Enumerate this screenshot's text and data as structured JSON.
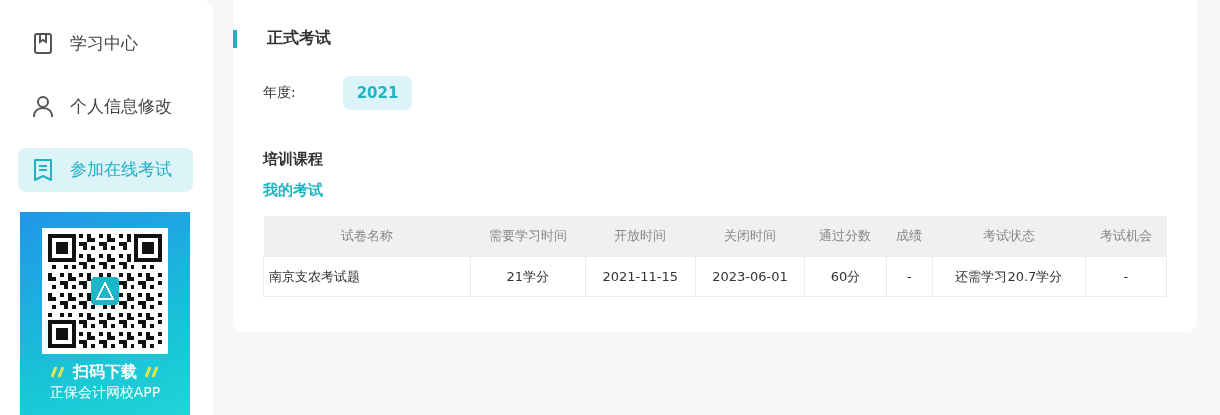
{
  "sidebar": {
    "items": [
      {
        "label": "学习中心",
        "selected": false
      },
      {
        "label": "个人信息修改",
        "selected": false
      },
      {
        "label": "参加在线考试",
        "selected": true
      }
    ],
    "banner": {
      "title": "扫码下载",
      "subtitle": "正保会计网校APP"
    }
  },
  "main": {
    "title": "正式考试",
    "year_label": "年度:",
    "years": [
      {
        "label": "2021",
        "selected": true
      }
    ],
    "section": "培训课程",
    "subsection": "我的考试",
    "table": {
      "columns": [
        "试卷名称",
        "需要学习时间",
        "开放时间",
        "关闭时间",
        "通过分数",
        "成绩",
        "考试状态",
        "考试机会"
      ],
      "rows": [
        [
          "南京支农考试题",
          "21学分",
          "2021-11-15",
          "2023-06-01",
          "60分",
          "-",
          "还需学习20.7学分",
          "-"
        ]
      ]
    }
  }
}
